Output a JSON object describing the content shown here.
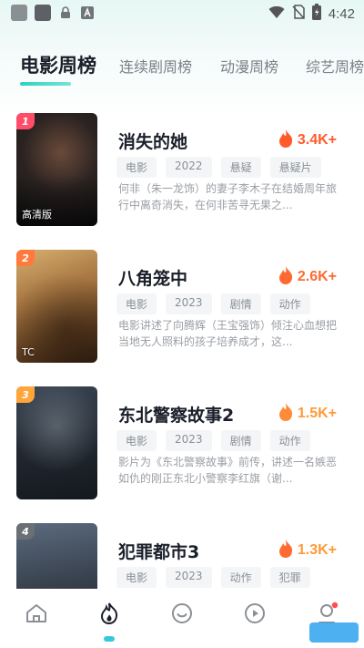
{
  "status_bar": {
    "time": "4:42",
    "icons": [
      "notification-square-icon",
      "notification-square-icon",
      "lock-icon",
      "font-icon",
      "wifi-icon",
      "no-sim-icon",
      "battery-icon"
    ]
  },
  "tabs": [
    {
      "label": "电影周榜",
      "active": true
    },
    {
      "label": "连续剧周榜",
      "active": false
    },
    {
      "label": "动漫周榜",
      "active": false
    },
    {
      "label": "综艺周榜",
      "active": false
    }
  ],
  "items": [
    {
      "rank": "1",
      "rank_color": "#ff4d6a",
      "poster_tag": "高清版",
      "title": "消失的她",
      "heat": "3.4K+",
      "heat_color": "#ff5a2c",
      "tags": [
        "电影",
        "2022",
        "悬疑",
        "悬疑片"
      ],
      "desc": "何非（朱一龙饰）的妻子李木子在结婚周年旅行中离奇消失，在何非苦寻无果之..."
    },
    {
      "rank": "2",
      "rank_color": "#ff7a3c",
      "poster_tag": "TC",
      "title": "八角笼中",
      "heat": "2.6K+",
      "heat_color": "#ff6a32",
      "tags": [
        "电影",
        "2023",
        "剧情",
        "动作"
      ],
      "desc": "电影讲述了向腾辉（王宝强饰）倾注心血想把当地无人照料的孩子培养成才，这..."
    },
    {
      "rank": "3",
      "rank_color": "#ffa53a",
      "poster_tag": "",
      "title": "东北警察故事2",
      "heat": "1.5K+",
      "heat_color": "#ff9a38",
      "tags": [
        "电影",
        "2023",
        "剧情",
        "动作"
      ],
      "desc": "影片为《东北警察故事》前传，讲述一名嫉恶如仇的刚正东北小警察李红旗（谢..."
    },
    {
      "rank": "4",
      "rank_color": "#6b6f76",
      "poster_tag": "",
      "title": "犯罪都市3",
      "heat": "1.3K+",
      "heat_color": "#ff9a38",
      "tags": [
        "电影",
        "2023",
        "动作",
        "犯罪"
      ],
      "desc": ""
    }
  ],
  "bottom_nav": [
    {
      "icon": "home-icon",
      "active": false
    },
    {
      "icon": "flame-icon",
      "active": true
    },
    {
      "icon": "chat-icon",
      "active": false
    },
    {
      "icon": "play-icon",
      "active": false
    },
    {
      "icon": "user-icon",
      "active": false,
      "badge": true
    }
  ]
}
